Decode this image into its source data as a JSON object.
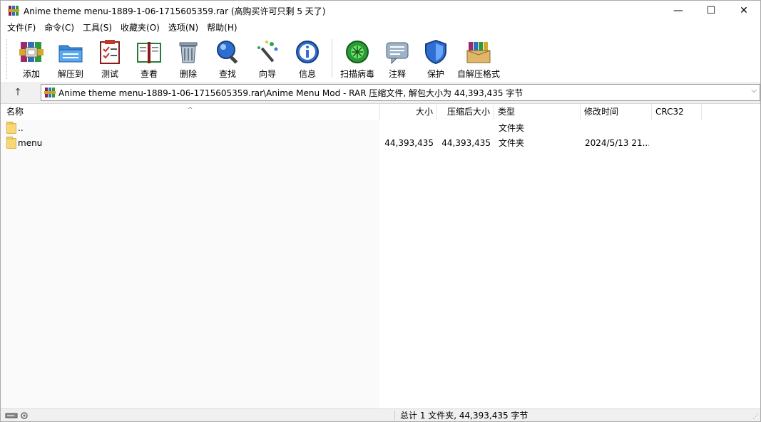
{
  "window": {
    "title": "Anime theme menu-1889-1-06-1715605359.rar (高购买许可只剩 5 天了)",
    "controls": {
      "minimize": "—",
      "maximize": "☐",
      "close": "✕"
    }
  },
  "menu": [
    "文件(F)",
    "命令(C)",
    "工具(S)",
    "收藏夹(O)",
    "选项(N)",
    "帮助(H)"
  ],
  "toolbar": {
    "add": "添加",
    "extract": "解压到",
    "test": "测试",
    "view": "查看",
    "delete": "删除",
    "find": "查找",
    "wizard": "向导",
    "info": "信息",
    "scan": "扫描病毒",
    "comment": "注释",
    "protect": "保护",
    "sfx": "自解压格式"
  },
  "address": {
    "up_icon": "↑",
    "path": "Anime theme menu-1889-1-06-1715605359.rar\\Anime Menu Mod - RAR 压缩文件, 解包大小为 44,393,435 字节",
    "dropdown": "⌵"
  },
  "columns": {
    "name": "名称",
    "size": "大小",
    "packed": "压缩后大小",
    "type": "类型",
    "modified": "修改时间",
    "crc": "CRC32",
    "sort_indicator": "^"
  },
  "rows": [
    {
      "name": "..",
      "size": "",
      "packed": "",
      "type": "文件夹",
      "modified": "",
      "crc": ""
    },
    {
      "name": "menu",
      "size": "44,393,435",
      "packed": "44,393,435",
      "type": "文件夹",
      "modified": "2024/5/13 21...",
      "crc": ""
    }
  ],
  "status": {
    "summary": "总计 1 文件夹, 44,393,435 字节"
  },
  "colors": {
    "folder": "#f8d775",
    "window_bg": "#f0f0f0",
    "list_bg": "#ffffff"
  }
}
